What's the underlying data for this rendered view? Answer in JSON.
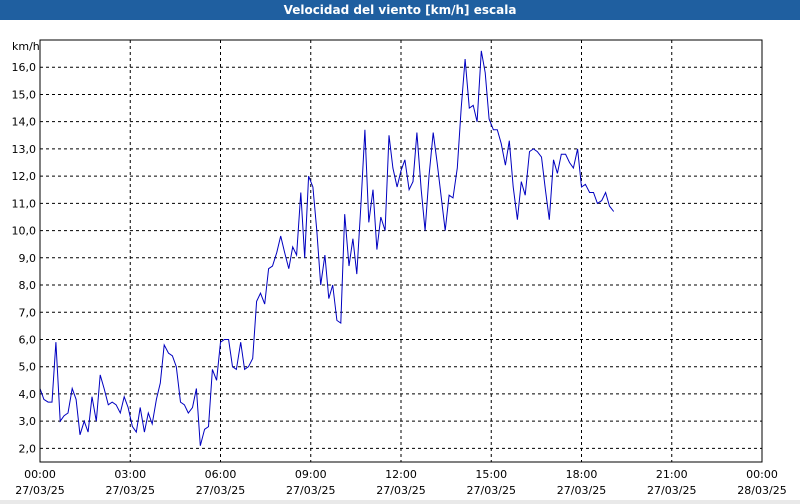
{
  "window": {
    "title": "Velocidad del viento [km/h] escala"
  },
  "colors": {
    "title_bar": "#1f5fa0",
    "series": "#0000c0",
    "grid": "#000000"
  },
  "chart_data": {
    "type": "line",
    "title": "Velocidad del viento [km/h] escala",
    "ylabel": "km/h",
    "xlabel": "",
    "ylim": [
      1.5,
      17.0
    ],
    "xlim_hours": [
      0,
      24
    ],
    "grid": true,
    "y_ticks": [
      "2,0",
      "3,0",
      "4,0",
      "5,0",
      "6,0",
      "7,0",
      "8,0",
      "9,0",
      "10,0",
      "11,0",
      "12,0",
      "13,0",
      "14,0",
      "15,0",
      "16,0"
    ],
    "x_ticks": [
      {
        "time": "00:00",
        "date": "27/03/25"
      },
      {
        "time": "03:00",
        "date": "27/03/25"
      },
      {
        "time": "06:00",
        "date": "27/03/25"
      },
      {
        "time": "09:00",
        "date": "27/03/25"
      },
      {
        "time": "12:00",
        "date": "27/03/25"
      },
      {
        "time": "15:00",
        "date": "27/03/25"
      },
      {
        "time": "18:00",
        "date": "27/03/25"
      },
      {
        "time": "21:00",
        "date": "27/03/25"
      },
      {
        "time": "00:00",
        "date": "28/03/25"
      }
    ],
    "series": [
      {
        "color": "#0000c0",
        "x_hours": [
          0.0,
          0.13,
          0.27,
          0.4,
          0.53,
          0.67,
          0.8,
          0.93,
          1.07,
          1.2,
          1.33,
          1.47,
          1.6,
          1.73,
          1.87,
          2.0,
          2.13,
          2.27,
          2.4,
          2.53,
          2.67,
          2.8,
          2.93,
          3.07,
          3.2,
          3.33,
          3.47,
          3.6,
          3.73,
          3.87,
          4.0,
          4.13,
          4.27,
          4.4,
          4.53,
          4.67,
          4.8,
          4.93,
          5.07,
          5.2,
          5.33,
          5.47,
          5.6,
          5.73,
          5.87,
          6.0,
          6.13,
          6.27,
          6.4,
          6.53,
          6.67,
          6.8,
          6.93,
          7.07,
          7.2,
          7.33,
          7.47,
          7.6,
          7.73,
          7.87,
          8.0,
          8.13,
          8.27,
          8.4,
          8.53,
          8.67,
          8.8,
          8.93,
          9.07,
          9.2,
          9.33,
          9.47,
          9.6,
          9.73,
          9.87,
          10.0,
          10.13,
          10.27,
          10.4,
          10.53,
          10.67,
          10.8,
          10.93,
          11.07,
          11.2,
          11.33,
          11.47,
          11.6,
          11.73,
          11.87,
          12.0,
          12.13,
          12.27,
          12.4,
          12.53,
          12.67,
          12.8,
          12.93,
          13.07,
          13.2,
          13.33,
          13.47,
          13.6,
          13.73,
          13.87,
          14.0,
          14.13,
          14.27,
          14.4,
          14.53,
          14.67,
          14.8,
          14.93,
          15.07,
          15.2,
          15.33,
          15.47,
          15.6,
          15.73,
          15.87,
          16.0,
          16.13,
          16.27,
          16.4,
          16.53,
          16.67,
          16.8,
          16.93,
          17.07,
          17.2,
          17.33,
          17.47,
          17.6,
          17.73,
          17.87,
          18.0,
          18.13,
          18.27,
          18.4,
          18.53,
          18.67,
          18.8,
          18.93,
          19.07,
          19.2,
          19.33,
          19.47,
          19.6,
          19.73,
          19.87,
          20.0,
          20.13,
          20.27,
          20.4,
          20.53,
          20.67,
          20.8,
          20.93,
          21.07,
          21.2,
          21.33,
          21.47,
          21.6,
          21.73,
          21.87,
          22.0,
          22.13,
          22.27,
          22.4,
          22.53,
          22.67,
          22.8,
          22.93,
          23.07,
          23.2,
          23.33,
          23.47,
          23.6,
          23.73,
          23.87
        ],
        "y": [
          4.2,
          3.8,
          3.7,
          3.7,
          5.9,
          3.0,
          3.2,
          3.3,
          4.2,
          3.8,
          2.5,
          3.0,
          2.6,
          3.9,
          3.0,
          4.7,
          4.2,
          3.6,
          3.7,
          3.6,
          3.3,
          3.9,
          3.5,
          2.8,
          2.6,
          3.5,
          2.6,
          3.3,
          2.9,
          3.8,
          4.4,
          5.8,
          5.5,
          5.4,
          5.0,
          3.7,
          3.6,
          3.3,
          3.5,
          4.2,
          2.1,
          2.7,
          2.8,
          4.9,
          4.5,
          5.9,
          6.0,
          6.0,
          5.0,
          4.9,
          5.9,
          4.9,
          5.0,
          5.3,
          7.4,
          7.7,
          7.3,
          8.6,
          8.7,
          9.2,
          9.8,
          9.2,
          8.6,
          9.4,
          9.1,
          11.4,
          9.0,
          12.0,
          11.6,
          10.0,
          8.0,
          9.1,
          7.5,
          8.0,
          6.7,
          6.6,
          10.6,
          8.7,
          9.7,
          8.4,
          11.0,
          13.7,
          10.3,
          11.5,
          9.3,
          10.5,
          10.0,
          13.5,
          12.3,
          11.6,
          12.2,
          12.6,
          11.5,
          11.8,
          13.6,
          11.5,
          10.0,
          12.0,
          13.6,
          12.5,
          11.3,
          10.0,
          11.3,
          11.2,
          12.3,
          14.5,
          16.3,
          14.5,
          14.6,
          14.0,
          16.6,
          15.8,
          14.1,
          13.7,
          13.7,
          13.2,
          12.4,
          13.3,
          11.6,
          10.4,
          11.8,
          11.3,
          12.9,
          13.0,
          12.9,
          12.7,
          11.5,
          10.4,
          12.6,
          12.1,
          12.8,
          12.8,
          12.5,
          12.3,
          13.0,
          11.6,
          11.7,
          11.4,
          11.4,
          11.0,
          11.1,
          11.4,
          10.9,
          10.7
        ]
      }
    ]
  }
}
